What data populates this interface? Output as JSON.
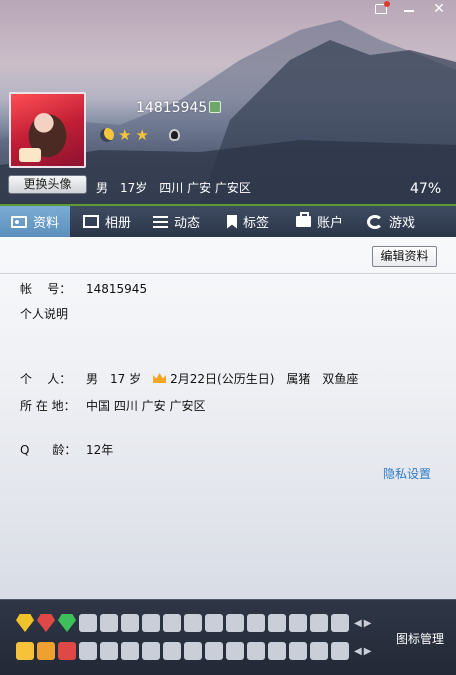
{
  "window": {
    "controls": {
      "skin_icon": "tshirt-icon",
      "minimize_icon": "minimize-icon",
      "close_label": "✕"
    }
  },
  "profile": {
    "qq_number": "14815945",
    "change_avatar_label": "更换头像",
    "gender": "男",
    "age": "17岁",
    "location": "四川 广安 广安区",
    "completion": "47%",
    "level_icons": [
      "moon-icon",
      "star-icon",
      "star-icon",
      "penguin-icon"
    ]
  },
  "tabs": [
    {
      "label": "资料",
      "icon": "profile-card-icon",
      "active": true
    },
    {
      "label": "相册",
      "icon": "album-icon",
      "active": false
    },
    {
      "label": "动态",
      "icon": "feed-icon",
      "active": false
    },
    {
      "label": "标签",
      "icon": "tag-icon",
      "active": false
    },
    {
      "label": "账户",
      "icon": "wallet-icon",
      "active": false
    },
    {
      "label": "游戏",
      "icon": "game-icon",
      "active": false
    }
  ],
  "details": {
    "edit_button": "编辑资料",
    "account_label": "帐    号：",
    "account_value": "14815945",
    "description_label": "个人说明",
    "personal_label": "个    人：",
    "personal_gender": "男",
    "personal_age": "17 岁",
    "birthday": "2月22日(公历生日)",
    "zodiac": "属猪",
    "constellation": "双鱼座",
    "location_label": "所 在 地：",
    "location_value": "中国 四川 广安 广安区",
    "qage_label": "Q      龄：",
    "qage_value": "12年",
    "privacy_link": "隐私设置"
  },
  "bottom_bar": {
    "manage_label": "图标管理",
    "row1_colors": [
      "#f0c22b",
      "#e04848",
      "#3fbf5a",
      "#c9ced8",
      "#c9ced8",
      "#c9ced8",
      "#c9ced8",
      "#c9ced8",
      "#c9ced8",
      "#c9ced8",
      "#c9ced8",
      "#c9ced8",
      "#c9ced8",
      "#c9ced8",
      "#c9ced8",
      "#c9ced8"
    ],
    "row2_colors": [
      "#f5c23a",
      "#f0a030",
      "#e04848",
      "#c9ced8",
      "#c9ced8",
      "#c9ced8",
      "#c9ced8",
      "#c9ced8",
      "#c9ced8",
      "#c9ced8",
      "#c9ced8",
      "#c9ced8",
      "#c9ced8",
      "#c9ced8",
      "#c9ced8",
      "#c9ced8"
    ]
  }
}
